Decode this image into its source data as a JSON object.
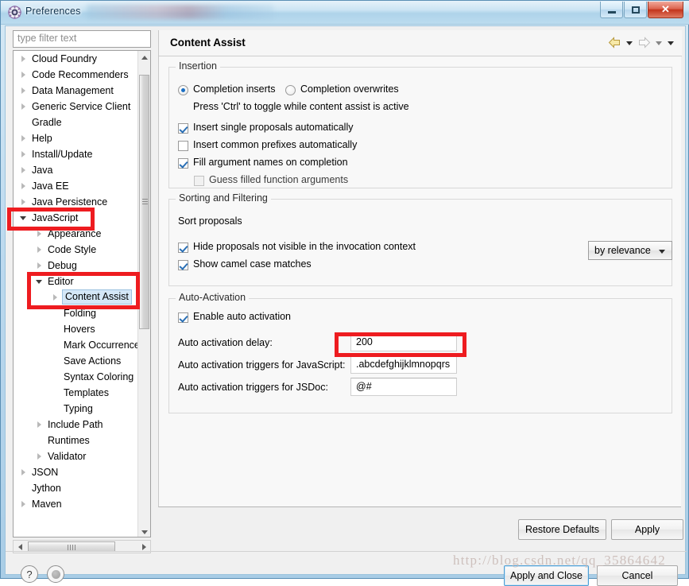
{
  "window": {
    "title": "Preferences",
    "icon": "preferences-gear-icon",
    "buttons": {
      "minimize": "Minimize",
      "maximize": "Maximize",
      "close": "Close"
    }
  },
  "sidebar": {
    "filter": {
      "value": "",
      "placeholder": "type filter text"
    },
    "items": [
      {
        "label": "Cloud Foundry",
        "indent": 0,
        "arrow": "collapsed"
      },
      {
        "label": "Code Recommenders",
        "indent": 0,
        "arrow": "collapsed"
      },
      {
        "label": "Data Management",
        "indent": 0,
        "arrow": "collapsed"
      },
      {
        "label": "Generic Service Client",
        "indent": 0,
        "arrow": "collapsed"
      },
      {
        "label": "Gradle",
        "indent": 0,
        "arrow": "none"
      },
      {
        "label": "Help",
        "indent": 0,
        "arrow": "collapsed"
      },
      {
        "label": "Install/Update",
        "indent": 0,
        "arrow": "collapsed"
      },
      {
        "label": "Java",
        "indent": 0,
        "arrow": "collapsed"
      },
      {
        "label": "Java EE",
        "indent": 0,
        "arrow": "collapsed"
      },
      {
        "label": "Java Persistence",
        "indent": 0,
        "arrow": "collapsed"
      },
      {
        "label": "JavaScript",
        "indent": 0,
        "arrow": "expanded"
      },
      {
        "label": "Appearance",
        "indent": 1,
        "arrow": "collapsed"
      },
      {
        "label": "Code Style",
        "indent": 1,
        "arrow": "collapsed"
      },
      {
        "label": "Debug",
        "indent": 1,
        "arrow": "collapsed"
      },
      {
        "label": "Editor",
        "indent": 1,
        "arrow": "expanded"
      },
      {
        "label": "Content Assist",
        "indent": 2,
        "arrow": "collapsed",
        "selected": true
      },
      {
        "label": "Folding",
        "indent": 2,
        "arrow": "none"
      },
      {
        "label": "Hovers",
        "indent": 2,
        "arrow": "none"
      },
      {
        "label": "Mark Occurrences",
        "indent": 2,
        "arrow": "none"
      },
      {
        "label": "Save Actions",
        "indent": 2,
        "arrow": "none"
      },
      {
        "label": "Syntax Coloring",
        "indent": 2,
        "arrow": "none"
      },
      {
        "label": "Templates",
        "indent": 2,
        "arrow": "none"
      },
      {
        "label": "Typing",
        "indent": 2,
        "arrow": "none"
      },
      {
        "label": "Include Path",
        "indent": 1,
        "arrow": "collapsed"
      },
      {
        "label": "Runtimes",
        "indent": 1,
        "arrow": "none"
      },
      {
        "label": "Validator",
        "indent": 1,
        "arrow": "collapsed"
      },
      {
        "label": "JSON",
        "indent": 0,
        "arrow": "collapsed"
      },
      {
        "label": "Jython",
        "indent": 0,
        "arrow": "none"
      },
      {
        "label": "Maven",
        "indent": 0,
        "arrow": "collapsed"
      }
    ]
  },
  "page": {
    "title": "Content Assist",
    "nav": {
      "back": "back-arrow-icon",
      "back_menu": "back-dropdown-icon",
      "forward": "forward-arrow-icon",
      "forward_menu": "forward-dropdown-icon",
      "view_menu": "view-menu-icon"
    },
    "insertion": {
      "title": "Insertion",
      "radio_inserts": {
        "label": "Completion inserts",
        "checked": true
      },
      "radio_overwrites": {
        "label": "Completion overwrites",
        "checked": false
      },
      "hint": "Press 'Ctrl' to toggle while content assist is active",
      "checks": [
        {
          "label": "Insert single proposals automatically",
          "checked": true,
          "disabled": false
        },
        {
          "label": "Insert common prefixes automatically",
          "checked": false,
          "disabled": false
        },
        {
          "label": "Fill argument names on completion",
          "checked": true,
          "disabled": false
        },
        {
          "label": "Guess filled function arguments",
          "checked": false,
          "disabled": true
        }
      ]
    },
    "sorting": {
      "title": "Sorting and Filtering",
      "sort_label": "Sort proposals",
      "sort_value": "by relevance",
      "checks": [
        {
          "label": "Hide proposals not visible in the invocation context",
          "checked": true
        },
        {
          "label": "Show camel case matches",
          "checked": true
        }
      ]
    },
    "auto_activation": {
      "title": "Auto-Activation",
      "enable": {
        "label": "Enable auto activation",
        "checked": true
      },
      "delay_label": "Auto activation delay:",
      "delay_value": "200",
      "js_label": "Auto activation triggers for JavaScript:",
      "js_value": ".abcdefghijklmnopqrs",
      "jsdoc_label": "Auto activation triggers for JSDoc:",
      "jsdoc_value": "@#"
    }
  },
  "footer": {
    "restore_defaults": "Restore Defaults",
    "apply": "Apply",
    "apply_and_close": "Apply and Close",
    "cancel": "Cancel",
    "help_icon": "?",
    "watermark": "http://blog.csdn.net/qq_35864642"
  },
  "colors": {
    "annotation_red": "#ee1c20",
    "selection_blue": "#d4e7f7",
    "accent_blue": "#1b6fc4"
  }
}
